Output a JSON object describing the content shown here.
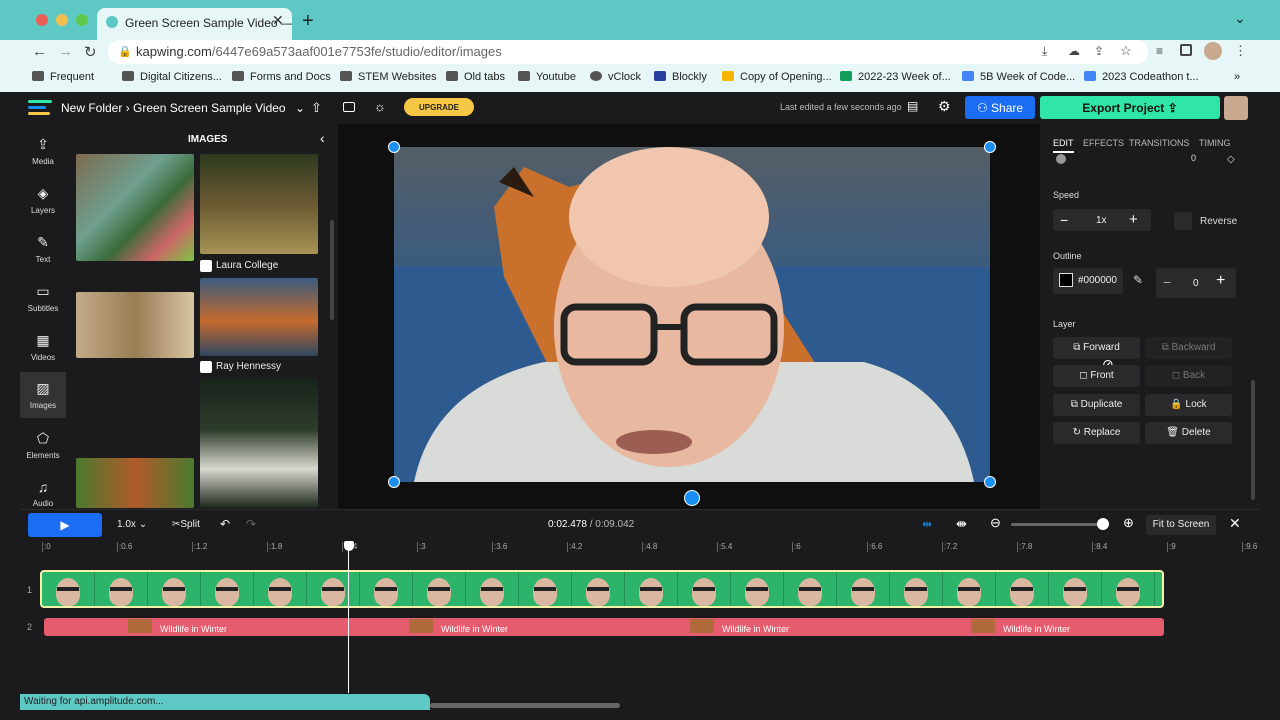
{
  "browser": {
    "tab_title": "Green Screen Sample Video —",
    "url_host": "kapwing.com",
    "url_path": "/6447e69a573aaf001e7753fe/studio/editor/images",
    "bookmarks": [
      "Frequent",
      "Digital Citizens...",
      "Forms and Docs",
      "STEM Websites",
      "Old tabs",
      "Youtube",
      "vClock",
      "Blockly",
      "Copy of Opening...",
      "2022-23 Week of...",
      "5B Week of Code...",
      "2023 Codeathon t..."
    ],
    "more": "»"
  },
  "header": {
    "folder": "New Folder",
    "sep": "›",
    "project": "Green Screen Sample Video",
    "upgrade": "UPGRADE",
    "last_edited": "Last edited a few seconds ago",
    "share": "Share",
    "export": "Export Project"
  },
  "rail": [
    {
      "label": "Media",
      "icon": "upload-icon"
    },
    {
      "label": "Layers",
      "icon": "layers-icon"
    },
    {
      "label": "Text",
      "icon": "text-icon"
    },
    {
      "label": "Subtitles",
      "icon": "subtitles-icon"
    },
    {
      "label": "Videos",
      "icon": "videos-icon"
    },
    {
      "label": "Images",
      "icon": "images-icon"
    },
    {
      "label": "Elements",
      "icon": "elements-icon"
    },
    {
      "label": "Audio",
      "icon": "audio-icon"
    }
  ],
  "images_panel": {
    "title": "IMAGES",
    "credit1": "Laura College",
    "credit2": "Ray Hennessy"
  },
  "right_panel": {
    "tabs": [
      "EDIT",
      "EFFECTS",
      "TRANSITIONS",
      "TIMING"
    ],
    "top_value": "0",
    "speed_label": "Speed",
    "speed_value": "1x",
    "reverse": "Reverse",
    "outline_label": "Outline",
    "outline_color": "#000000",
    "outline_value": "0",
    "layer_label": "Layer",
    "buttons": [
      "Forward",
      "Backward",
      "Front",
      "Back",
      "Duplicate",
      "Lock",
      "Replace",
      "Delete"
    ]
  },
  "timeline": {
    "speed": "1.0x",
    "split": "Split",
    "current": "0:02.478",
    "divider": " / ",
    "total": "0:09.042",
    "fit": "Fit to Screen",
    "ticks": [
      ":0",
      ":0.6",
      ":1.2",
      ":1.8",
      ":2.4",
      ":3",
      ":3.6",
      ":4.2",
      ":4.8",
      ":5.4",
      ":6",
      ":6.6",
      ":7.2",
      ":7.8",
      ":8.4",
      ":9",
      ":9.6"
    ],
    "track_numbers": [
      "1",
      "2"
    ],
    "layer2_label": "Wildlife in Winter"
  },
  "status": "Waiting for api.amplitude.com...",
  "colors": {
    "accent": "#1b6ef3",
    "export": "#30e6a7",
    "chrome": "#5ec8c5",
    "layer2": "#e45c6d",
    "track1": "#2cb46b"
  }
}
